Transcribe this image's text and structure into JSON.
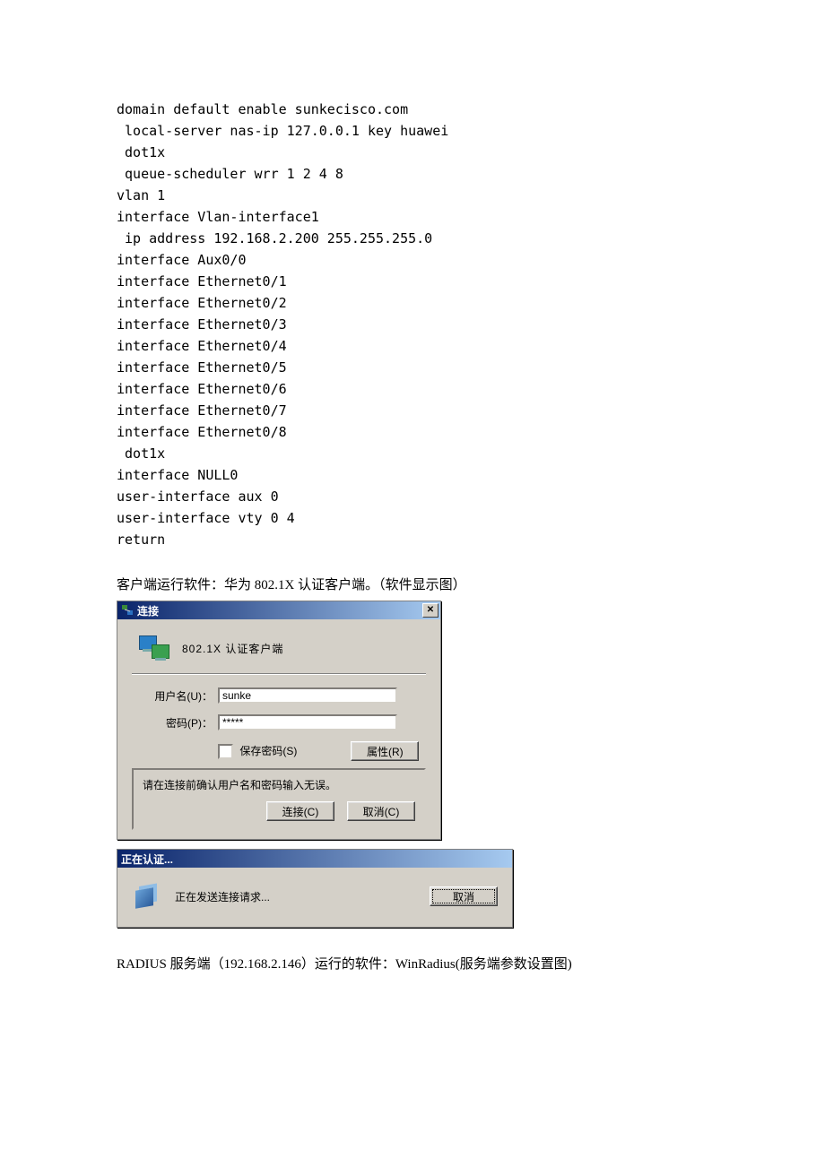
{
  "code": {
    "lines": [
      "domain default enable sunkecisco.com",
      " local-server nas-ip 127.0.0.1 key huawei",
      " dot1x",
      " queue-scheduler wrr 1 2 4 8",
      "vlan 1",
      "interface Vlan-interface1",
      " ip address 192.168.2.200 255.255.255.0",
      "interface Aux0/0",
      "interface Ethernet0/1",
      "interface Ethernet0/2",
      "interface Ethernet0/3",
      "interface Ethernet0/4",
      "interface Ethernet0/5",
      "interface Ethernet0/6",
      "interface Ethernet0/7",
      "interface Ethernet0/8",
      " dot1x",
      "interface NULL0",
      "user-interface aux 0",
      "user-interface vty 0 4",
      "return"
    ]
  },
  "caption1": "客户端运行软件：华为 802.1X 认证客户端。（软件显示图）",
  "dialog1": {
    "title": "连接",
    "close_glyph": "✕",
    "banner": "802.1X 认证客户端",
    "username_label": "用户名(U)：",
    "username_value": "sunke",
    "password_label": "密码(P)：",
    "password_value": "*****",
    "save_pwd_label": "保存密码(S)",
    "properties_btn": "属性(R)",
    "status_text": "请在连接前确认用户名和密码输入无误。",
    "connect_btn": "连接(C)",
    "cancel_btn": "取消(C)"
  },
  "dialog2": {
    "title": "正在认证...",
    "body_text": "正在发送连接请求...",
    "cancel_btn": "取消"
  },
  "caption2": "RADIUS 服务端（192.168.2.146）运行的软件：WinRadius(服务端参数设置图)"
}
